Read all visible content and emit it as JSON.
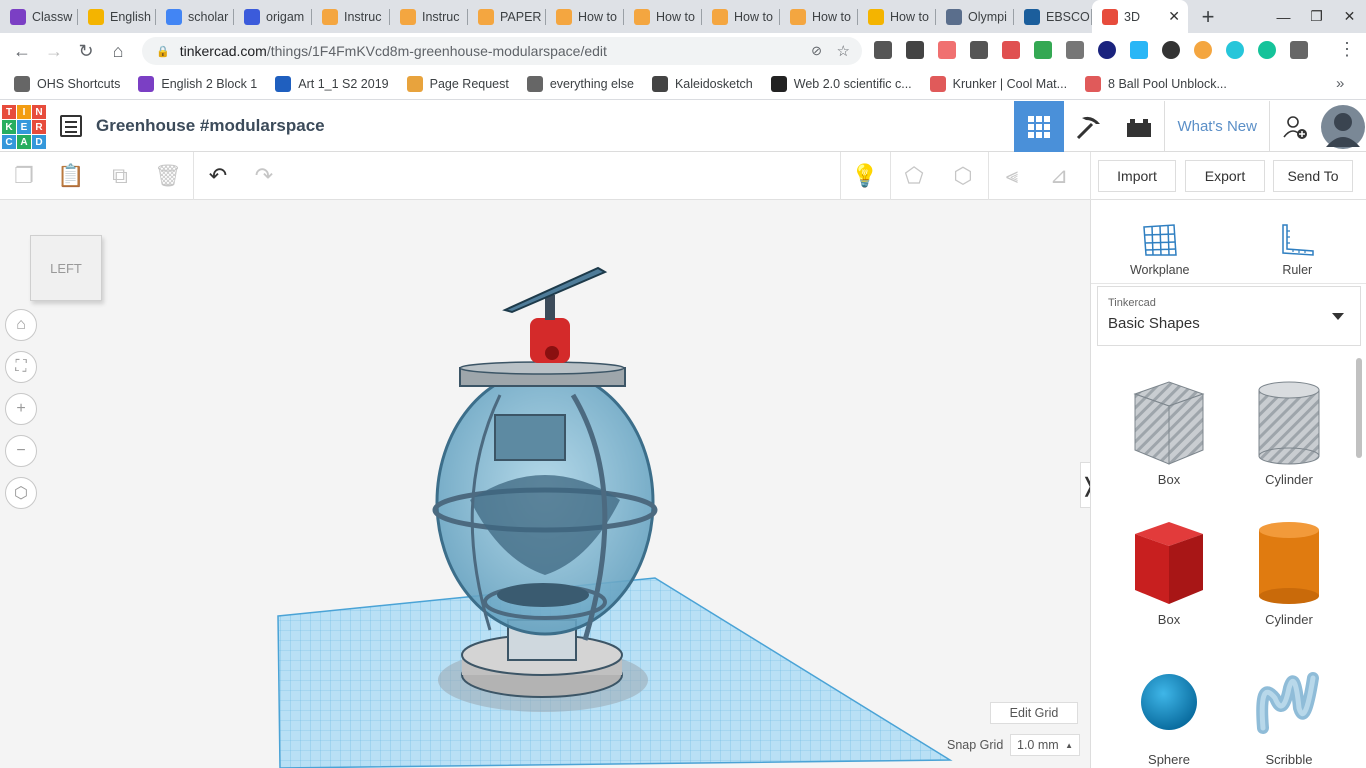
{
  "browser": {
    "tabs": [
      {
        "label": "Classw",
        "color": "#7b3fc4"
      },
      {
        "label": "English",
        "color": "#f4b400"
      },
      {
        "label": "scholar",
        "color": "#4285f4"
      },
      {
        "label": "origam",
        "color": "#3b5bdb"
      },
      {
        "label": "Instruc",
        "color": "#f4a640"
      },
      {
        "label": "Instruc",
        "color": "#f4a640"
      },
      {
        "label": "PAPER",
        "color": "#f4a640"
      },
      {
        "label": "How to",
        "color": "#f4a640"
      },
      {
        "label": "How to",
        "color": "#f4a640"
      },
      {
        "label": "How to",
        "color": "#f4a640"
      },
      {
        "label": "How to",
        "color": "#f4a640"
      },
      {
        "label": "How to",
        "color": "#f4b400"
      },
      {
        "label": "Olympi",
        "color": "#5a6e8c"
      },
      {
        "label": "EBSCO",
        "color": "#1b5e9c"
      }
    ],
    "active_tab": {
      "label": "3D",
      "close": "✕"
    },
    "new_tab": "+",
    "url_domain": "tinkercad.com",
    "url_path": "/things/1F4FmKVcd8m-greenhouse-modularspace/edit",
    "bookmarks": [
      {
        "label": "OHS Shortcuts",
        "color": "#666"
      },
      {
        "label": "English 2 Block 1",
        "color": "#7b3fc4"
      },
      {
        "label": "Art 1_1 S2 2019",
        "color": "#1f5fbf"
      },
      {
        "label": "Page Request",
        "color": "#e8a33d"
      },
      {
        "label": "everything else",
        "color": "#666"
      },
      {
        "label": "Kaleidosketch",
        "color": "#444"
      },
      {
        "label": "Web 2.0 scientific c...",
        "color": "#222"
      },
      {
        "label": "Krunker | Cool Mat...",
        "color": "#e05a5a"
      },
      {
        "label": "8 Ball Pool Unblock...",
        "color": "#e05a5a"
      }
    ],
    "more_bookmarks": "»"
  },
  "app": {
    "logo_letters": [
      "T",
      "I",
      "N",
      "K",
      "E",
      "R",
      "C",
      "A",
      "D"
    ],
    "logo_colors": [
      "#e74c3c",
      "#f39c12",
      "#e74c3c",
      "#27ae60",
      "#3498db",
      "#e74c3c",
      "#3498db",
      "#27ae60",
      "#3498db"
    ],
    "design_title": "Greenhouse #modularspace",
    "whats_new": "What's New"
  },
  "toolbar": {
    "import": "Import",
    "export": "Export",
    "send_to": "Send To"
  },
  "viewport": {
    "viewcube_label": "LEFT",
    "edit_grid": "Edit Grid",
    "snap_grid_label": "Snap Grid",
    "snap_grid_value": "1.0 mm"
  },
  "panel": {
    "workplane": "Workplane",
    "ruler": "Ruler",
    "library_sub": "Tinkercad",
    "library_main": "Basic Shapes",
    "shapes": [
      {
        "label": "Box",
        "kind": "box-hole"
      },
      {
        "label": "Cylinder",
        "kind": "cylinder-hole"
      },
      {
        "label": "Box",
        "kind": "box-red"
      },
      {
        "label": "Cylinder",
        "kind": "cylinder-orange"
      },
      {
        "label": "Sphere",
        "kind": "sphere-blue"
      },
      {
        "label": "Scribble",
        "kind": "scribble"
      }
    ]
  }
}
